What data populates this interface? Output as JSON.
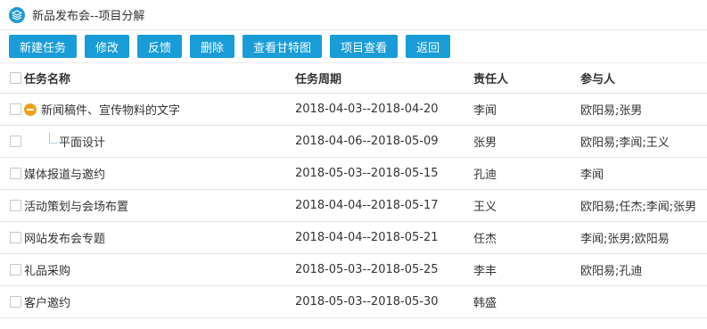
{
  "header": {
    "title": "新品发布会--项目分解",
    "icon": "layers-icon"
  },
  "toolbar": {
    "buttons": [
      "新建任务",
      "修改",
      "反馈",
      "删除",
      "查看甘特图",
      "项目查看",
      "返回"
    ]
  },
  "table": {
    "columns": [
      "任务名称",
      "任务周期",
      "责任人",
      "参与人"
    ],
    "rows": [
      {
        "name": "新闻稿件、宣传物料的文字",
        "period": "2018-04-03--2018-04-20",
        "owner": "李闻",
        "participants": "欧阳易;张男"
      },
      {
        "name": "平面设计",
        "period": "2018-04-06--2018-05-09",
        "owner": "张男",
        "participants": "欧阳易;李闻;王义"
      },
      {
        "name": "媒体报道与邀约",
        "period": "2018-05-03--2018-05-15",
        "owner": "孔迪",
        "participants": "李闻"
      },
      {
        "name": "活动策划与会场布置",
        "period": "2018-04-04--2018-05-17",
        "owner": "王义",
        "participants": "欧阳易;任杰;李闻;张男"
      },
      {
        "name": "网站发布会专题",
        "period": "2018-04-04--2018-05-21",
        "owner": "任杰",
        "participants": "李闻;张男;欧阳易"
      },
      {
        "name": "礼品采购",
        "period": "2018-05-03--2018-05-25",
        "owner": "李丰",
        "participants": "欧阳易;孔迪"
      },
      {
        "name": "客户邀约",
        "period": "2018-05-03--2018-05-30",
        "owner": "韩盛",
        "participants": ""
      }
    ]
  },
  "colors": {
    "accent": "#1a9cd8",
    "collapse": "#f0a11a"
  }
}
